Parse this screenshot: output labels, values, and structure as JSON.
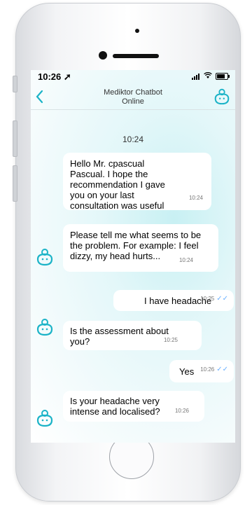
{
  "status_bar": {
    "time": "10:26 ➚"
  },
  "header": {
    "title": "Mediktor Chatbot",
    "subtitle": "Online"
  },
  "chat": {
    "date_stamp": "10:24",
    "messages": [
      {
        "from": "bot",
        "text": "Hello Mr. cpascual Pascual. I hope the recommendation I gave you on your last consultation was useful",
        "time": "10:24"
      },
      {
        "from": "bot",
        "text": "Please tell me what seems to be the problem. For example: I feel dizzy, my head hurts...",
        "time": "10:24"
      },
      {
        "from": "user",
        "text": "I have headache",
        "time": "10:25"
      },
      {
        "from": "bot",
        "text": "Is the assessment about you?",
        "time": "10:25"
      },
      {
        "from": "user",
        "text": "Yes",
        "time": "10:26"
      },
      {
        "from": "bot",
        "text": "Is your headache very intense and localised?",
        "time": "10:26"
      }
    ]
  },
  "colors": {
    "accent": "#1bb3c7",
    "read_check": "#6ab0ff"
  },
  "icons": {
    "back": "chevron-left-icon",
    "bot": "bot-avatar-icon",
    "read": "double-check-icon"
  }
}
